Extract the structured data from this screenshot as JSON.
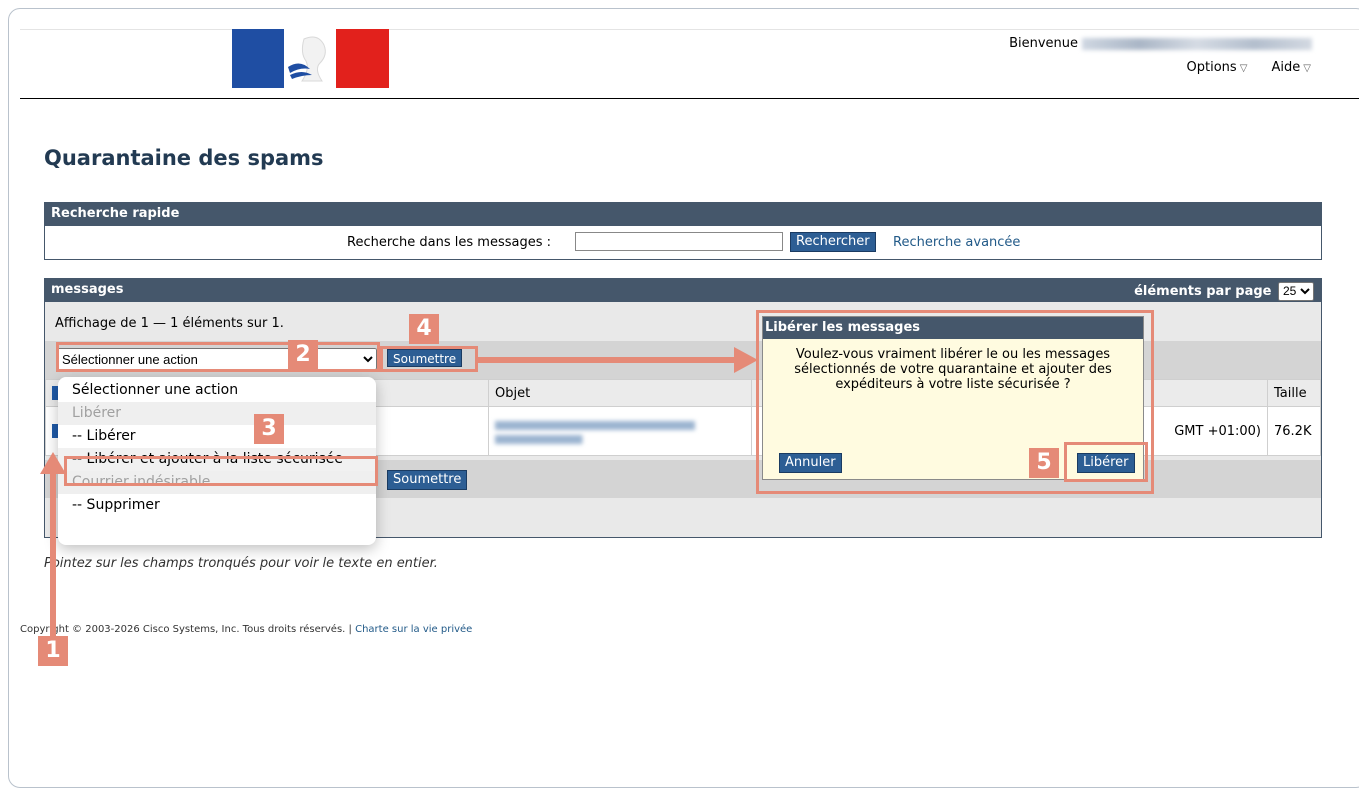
{
  "header": {
    "welcome_label": "Bienvenue",
    "menu_options": "Options",
    "menu_aide": "Aide"
  },
  "page_title": "Quarantaine des spams",
  "quick_search": {
    "title": "Recherche rapide",
    "label": "Recherche dans les messages :",
    "value": "",
    "button": "Rechercher",
    "advanced_link": "Recherche avancée"
  },
  "messages": {
    "title": "messages",
    "per_page_label": "éléments par page",
    "per_page_value": "25",
    "display_count": "Affichage de 1 — 1 éléments sur 1.",
    "action_select_value": "Sélectionner une action",
    "submit_label": "Soumettre",
    "columns": [
      "Objet",
      "Taille"
    ],
    "row": {
      "date_suffix": "GMT +01:00)",
      "size": "76.2K"
    }
  },
  "dropdown": {
    "items": [
      {
        "label": "Sélectionner une action",
        "type": "option"
      },
      {
        "label": "Libérer",
        "type": "group"
      },
      {
        "label": "-- Libérer",
        "type": "option"
      },
      {
        "label": "-- Libérer et ajouter à la liste sécurisée",
        "type": "option",
        "highlight": true
      },
      {
        "label": "Courrier indésirable",
        "type": "group"
      },
      {
        "label": "-- Supprimer",
        "type": "option"
      }
    ],
    "highlighted_label": "Libérer et ajouter à la liste sécurisée"
  },
  "modal": {
    "title": "Libérer les messages",
    "text": "Voulez-vous vraiment libérer le ou les messages sélectionnés de votre quarantaine et ajouter des expéditeurs à votre liste sécurisée ?",
    "cancel": "Annuler",
    "confirm": "Libérer"
  },
  "hint": "Pointez sur les champs tronqués pour voir le texte en entier.",
  "footer": {
    "copyright": "Copyright © 2003-2026 Cisco Systems, Inc. Tous droits réservés. |",
    "privacy_link": "Charte sur la vie privée"
  },
  "callouts": {
    "steps": [
      "1",
      "2",
      "3",
      "4",
      "5"
    ],
    "color": "#e58a77"
  }
}
